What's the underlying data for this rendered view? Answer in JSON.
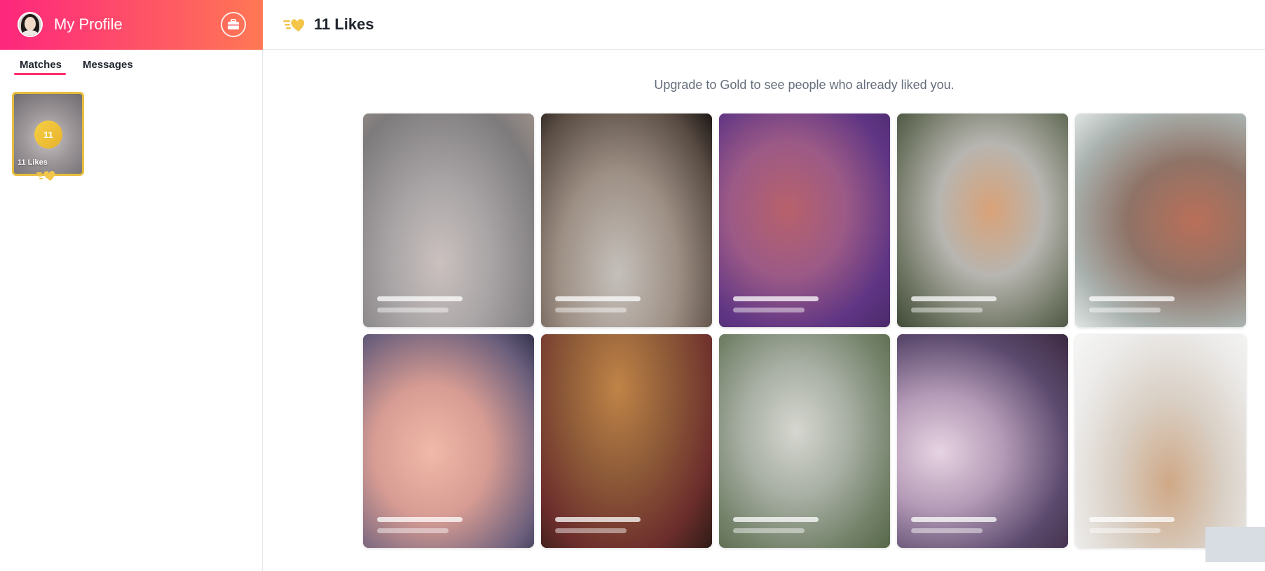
{
  "sidebar": {
    "header": {
      "title": "My Profile",
      "avatar_icon": "avatar-icon",
      "action_icon": "briefcase-icon"
    },
    "tabs": [
      {
        "label": "Matches",
        "active": true
      },
      {
        "label": "Messages",
        "active": false
      }
    ],
    "likes_card": {
      "count": "11",
      "label": "11 Likes",
      "icon": "gold-heart-icon"
    }
  },
  "main": {
    "header": {
      "title": "11 Likes",
      "icon": "gold-heart-icon"
    },
    "upgrade_message": "Upgrade to Gold to see people who already liked you.",
    "tiles_count": 10
  },
  "colors": {
    "brand_gradient_start": "#fd267d",
    "brand_gradient_end": "#ff7854",
    "gold": "#e7bd3c",
    "active_tab_underline": "#fd2c6c"
  }
}
